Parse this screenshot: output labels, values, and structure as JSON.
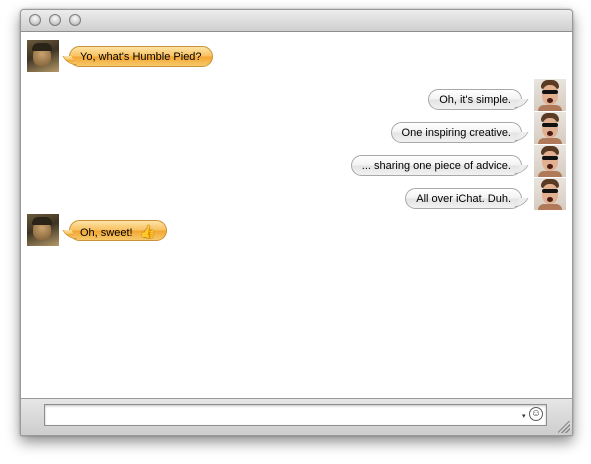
{
  "window": {
    "controls": [
      "close",
      "minimize",
      "zoom"
    ]
  },
  "transcript": {
    "messages": [
      {
        "from": "buddy",
        "text": "Yo, what's Humble Pied?",
        "bubble_color": "#f9c05c"
      },
      {
        "from": "me",
        "text": "Oh, it's simple.",
        "bubble_color": "#ececec"
      },
      {
        "from": "me",
        "text": "One inspiring creative.",
        "bubble_color": "#ececec"
      },
      {
        "from": "me",
        "text": "... sharing one piece of advice.",
        "bubble_color": "#ececec"
      },
      {
        "from": "me",
        "text": "All over iChat. Duh.",
        "bubble_color": "#ececec"
      },
      {
        "from": "buddy",
        "text": "Oh, sweet!",
        "bubble_color": "#f9c05c",
        "icon": "thumbs-up-icon",
        "icon_glyph": "👍"
      }
    ]
  },
  "compose": {
    "value": "",
    "placeholder": "",
    "smiley_glyph": "☺",
    "dropdown_glyph": "▾"
  }
}
